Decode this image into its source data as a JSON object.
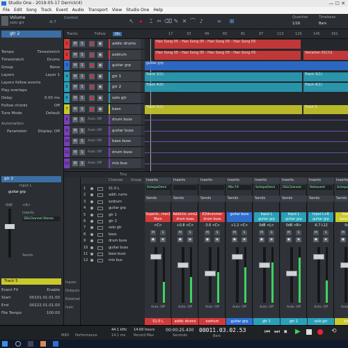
{
  "window": {
    "title": "Studio One - 2019-05-17 Derrick(4)"
  },
  "menu": [
    "File",
    "Edit",
    "Song",
    "Track",
    "Event",
    "Audio",
    "Transport",
    "View",
    "Studio One",
    "Help"
  ],
  "toolbar": {
    "volume_label": "Volume",
    "volume_value": "-6.7",
    "track_name": "solo gtr",
    "control_label": "Control",
    "quantize_label": "Quantize",
    "quantize_value": "1/16",
    "timebase_label": "Timebase",
    "timebase_value": "Bars"
  },
  "inspector": {
    "track_name": "gtr 2",
    "rows": [
      {
        "label": "Tempo",
        "value": "Timestretch"
      },
      {
        "label": "Timestretch",
        "value": "Drums"
      },
      {
        "label": "Group",
        "value": "None"
      },
      {
        "label": "Layers",
        "value": "Layer 1"
      },
      {
        "label": "Layers follow events",
        "value": ""
      },
      {
        "label": "Play overlaps",
        "value": ""
      },
      {
        "label": "Delay",
        "value": "0.00 ms"
      },
      {
        "label": "Follow chords",
        "value": "Off"
      },
      {
        "label": "Tune Mode",
        "value": "Default"
      }
    ],
    "automation_label": "Automation",
    "parameter_label": "Parameter",
    "display_label": "Display: Off",
    "channel_name": "gtr 2",
    "input_label": "Input L",
    "bus_label": "guitar grp",
    "value_0db": "0dB",
    "value_lr": "<R>",
    "inserts_label": "Inserts",
    "insert_plugin": "SSLChannel Stereo",
    "sends_label": "Sends",
    "event_track": "Track 5",
    "event_fx_label": "Event FX",
    "event_fx_value": "Enable",
    "start_label": "Start",
    "start_value": "00101.01.01.00",
    "end_label": "End",
    "end_value": "00222.01.01.00",
    "file_tempo_label": "File Tempo",
    "file_tempo_value": "100.00"
  },
  "tracks_header": {
    "tracks": "Tracks",
    "follow": "Follow",
    "on": "On"
  },
  "tracks": [
    {
      "num": "1",
      "name": "addic drums",
      "color": "#d23a3a",
      "auto": ""
    },
    {
      "num": "2",
      "name": "ezdrum",
      "color": "#d23a3a",
      "auto": ""
    },
    {
      "num": "3",
      "name": "guitar grp",
      "color": "#2f6fd0",
      "auto": ""
    },
    {
      "num": "4",
      "name": "gtr 1",
      "color": "#2aa0b8",
      "auto": ""
    },
    {
      "num": "5",
      "name": "gtr 2",
      "color": "#2aa0b8",
      "auto": ""
    },
    {
      "num": "6",
      "name": "solo gtr",
      "color": "#2aa0b8",
      "auto": ""
    },
    {
      "num": "7",
      "name": "bass",
      "color": "#c9c92a",
      "auto": ""
    },
    {
      "num": "8",
      "name": "drum buss",
      "color": "#7a3fb8",
      "auto": "Auto: Off"
    },
    {
      "num": "9",
      "name": "guitar buss",
      "color": "#7a3fb8",
      "auto": "Auto: Off"
    },
    {
      "num": "10",
      "name": "bass buss",
      "color": "#7a3fb8",
      "auto": "Auto: Off"
    },
    {
      "num": "11",
      "name": "drum buss",
      "color": "#7a3fb8",
      "auto": "Auto: Off"
    },
    {
      "num": "12",
      "name": "mix bus",
      "color": "#7a3fb8",
      "auto": "Auto: Off"
    }
  ],
  "ruler": {
    "marks": [
      "17",
      "33",
      "49",
      "65",
      "81",
      "97",
      "113",
      "129",
      "145",
      "161"
    ]
  },
  "clips": [
    {
      "label": "Han Song 05 - Han Song 05 - Han Song 05 - Han Song 05",
      "color": "#d23a3a"
    },
    {
      "label": "Han Song 05 - Han Song 05 - Han Song 05 - Han Song 05",
      "color": "#d23a3a"
    },
    {
      "label": "guitar grp",
      "color": "#2f6fd0"
    },
    {
      "label": "Variation 01Ch1",
      "color": "#d23a3a"
    },
    {
      "label": "Track 3(1)",
      "color": "#2aa0b8"
    },
    {
      "label": "Track 4(0)",
      "color": "#2aa0b8"
    },
    {
      "label": "Track 3(1)",
      "color": "#2aa0b8"
    },
    {
      "label": "Track 4(1)",
      "color": "#2aa0b8"
    },
    {
      "label": "Track 5(2)",
      "color": "#c9c92a"
    },
    {
      "label": "Track 5",
      "color": "#c9c92a"
    }
  ],
  "tiny_label": "Tiny",
  "channel_list": {
    "header_channel": "Channel",
    "header_group": "Group",
    "rows": [
      {
        "num": "1",
        "name": "S1:0 L"
      },
      {
        "num": "2",
        "name": "addi..rums"
      },
      {
        "num": "3",
        "name": "ezdrum"
      },
      {
        "num": "4",
        "name": "guitar grp"
      },
      {
        "num": "5",
        "name": "gtr 1"
      },
      {
        "num": "6",
        "name": "gtr 2"
      },
      {
        "num": "7",
        "name": "solo gtr"
      },
      {
        "num": "8",
        "name": "bass"
      },
      {
        "num": "9",
        "name": "drum buss"
      },
      {
        "num": "10",
        "name": "guitar buss"
      },
      {
        "num": "11",
        "name": "bass buss"
      },
      {
        "num": "12",
        "name": "mix bus"
      }
    ],
    "side_items": [
      "Inputs",
      "Outputs",
      "External",
      "Instr."
    ]
  },
  "mixer": {
    "strips": [
      {
        "insert": "SchepsOmni",
        "io_top": "Superio...mer2",
        "io_bot": "Main",
        "val": "<C>",
        "name": "S1:0 L",
        "color": "#d23a3a"
      },
      {
        "insert": "",
        "io_top": "Addictiv..ums2",
        "io_bot": "drum buss",
        "val": "+0.8  <C>",
        "name": "addic drums",
        "color": "#d23a3a"
      },
      {
        "insert": "",
        "io_top": "EZdrummer",
        "io_bot": "drum buss",
        "val": "-3.6  <C>",
        "name": "ezdrum",
        "color": "#d23a3a"
      },
      {
        "insert": "Mix FX",
        "io_top": "",
        "io_bot": "guitar buss",
        "val": "+1.2  <C>",
        "name": "guitar grp",
        "color": "#2f6fd0"
      },
      {
        "insert": "SchepsOmni",
        "io_top": "Input L",
        "io_bot": "guitar grp",
        "val": "0dB  <L>",
        "name": "gtr 1",
        "color": "#2aa0b8"
      },
      {
        "insert": "SSLChannel",
        "io_top": "Input L",
        "io_bot": "guitar grp",
        "val": "0dB  <R>",
        "name": "gtr 2",
        "color": "#2aa0b8"
      },
      {
        "insert": "Retrovent",
        "io_top": "Input L+R",
        "io_bot": "guitar grp",
        "val": "-6.7  L12",
        "name": "solo gtr",
        "color": "#2aa0b8"
      },
      {
        "insert": "SchepsOmni",
        "io_top": "Input L",
        "io_bot": "bass buss",
        "val": "0dB",
        "name": "bass",
        "color": "#c9c92a"
      }
    ],
    "inserts_label": "Inserts",
    "sends_label": "Sends",
    "mute": "M",
    "solo": "S",
    "auto_off": "Auto: Off"
  },
  "transport": {
    "midi_label": "MIDI",
    "performance_label": "Performance",
    "sample_rate": "44.1 kHz",
    "sample_sub": "14.1 ms",
    "record_time": "14:00 hours",
    "record_sub": "Record Max",
    "seconds": "00:00:25.430",
    "seconds_sub": "Seconds",
    "bars": "00011.03.02.53",
    "bars_sub": "Bars",
    "remove_label": "Remove"
  }
}
